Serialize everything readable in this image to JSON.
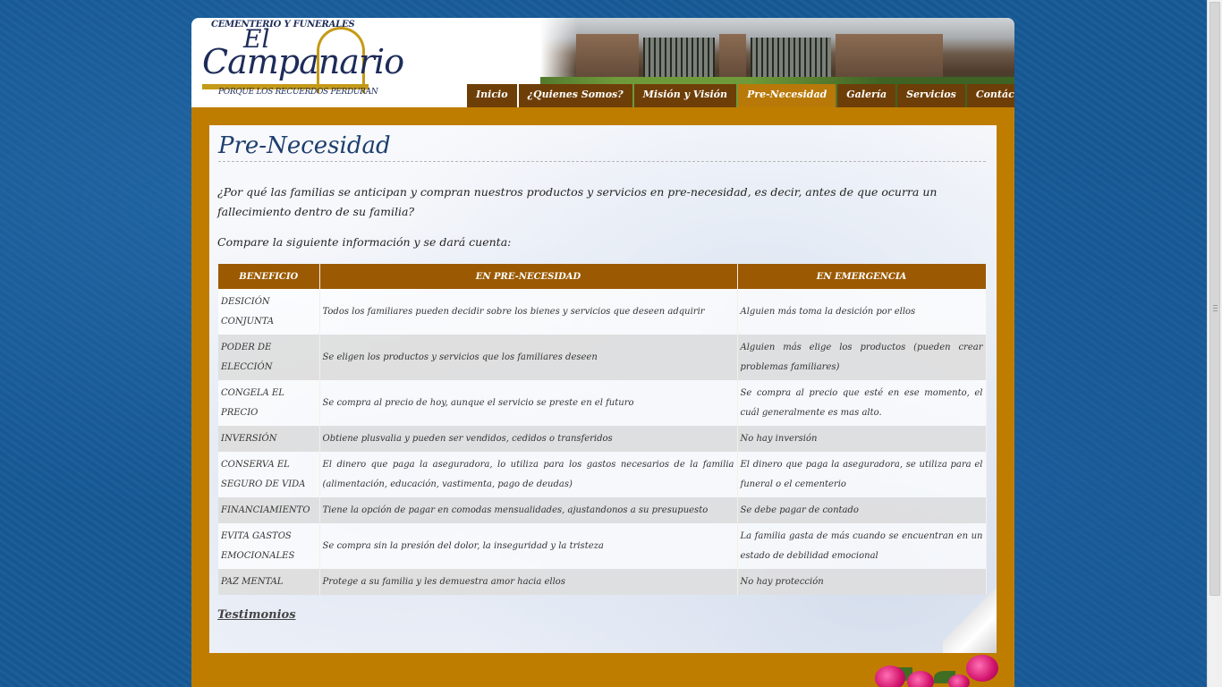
{
  "header": {
    "logo_top": "CEMENTERIO Y FUNERALES",
    "logo_el": "El",
    "logo_main": "Campanario",
    "logo_slogan": "PORQUE LOS RECUERDOS PERDURAN"
  },
  "nav": {
    "items": [
      {
        "label": "Inicio"
      },
      {
        "label": "¿Quienes Somos?"
      },
      {
        "label": "Misión y Visión"
      },
      {
        "label": "Pre-Necesidad",
        "active": true
      },
      {
        "label": "Galería"
      },
      {
        "label": "Servicios"
      },
      {
        "label": "Contáctenos"
      }
    ]
  },
  "page": {
    "title": "Pre-Necesidad",
    "intro": "¿Por qué las familias se anticipan y compran nuestros productos y servicios en pre-necesidad, es decir, antes de que ocurra un fallecimiento dentro de su familia?",
    "compare": "Compare la siguiente información y se dará cuenta:",
    "testimonios": "Testimonios"
  },
  "table": {
    "headers": [
      "BENEFICIO",
      "EN PRE-NECESIDAD",
      "EN EMERGENCIA"
    ],
    "rows": [
      [
        "DESICIÓN CONJUNTA",
        "Todos los familiares pueden decidir sobre los bienes y servicios que deseen adquirir",
        "Alguien más toma la desición por ellos"
      ],
      [
        "PODER DE ELECCIÓN",
        "Se eligen los productos y servicios que los familiares deseen",
        "Alguien más elige los productos (pueden crear problemas familiares)"
      ],
      [
        "CONGELA EL PRECIO",
        "Se compra al precio de hoy, aunque el servicio se preste en el futuro",
        "Se compra al precio que esté en ese momento, el cuál generalmente es mas alto."
      ],
      [
        "INVERSIÓN",
        "Obtiene plusvalia y pueden ser vendidos, cedidos o transferidos",
        "No hay inversión"
      ],
      [
        "CONSERVA EL SEGURO DE VIDA",
        "El dinero que paga la aseguradora, lo utiliza para los gastos necesarios de la familia (alimentación, educación, vastimenta, pago de deudas)",
        "El dinero que paga la aseguradora, se utiliza para el funeral o el cementerio"
      ],
      [
        "FINANCIAMIENTO",
        "Tiene la opción de pagar en comodas mensualidades, ajustandonos a su presupuesto",
        "Se debe pagar de contado"
      ],
      [
        "EVITA GASTOS EMOCIONALES",
        "Se compra sin la presión del dolor, la inseguridad y la tristeza",
        "La familia gasta de más cuando se encuentran en un estado de debilidad emocional"
      ],
      [
        "PAZ MENTAL",
        "Protege a su familia y les demuestra amor hacia ellos",
        "No hay protección"
      ]
    ]
  },
  "colors": {
    "nav_bg": "#6e3e08",
    "nav_active": "#b87908",
    "band": "#bf7d00",
    "table_header": "#9b5a02",
    "title": "#1d3f6e"
  }
}
